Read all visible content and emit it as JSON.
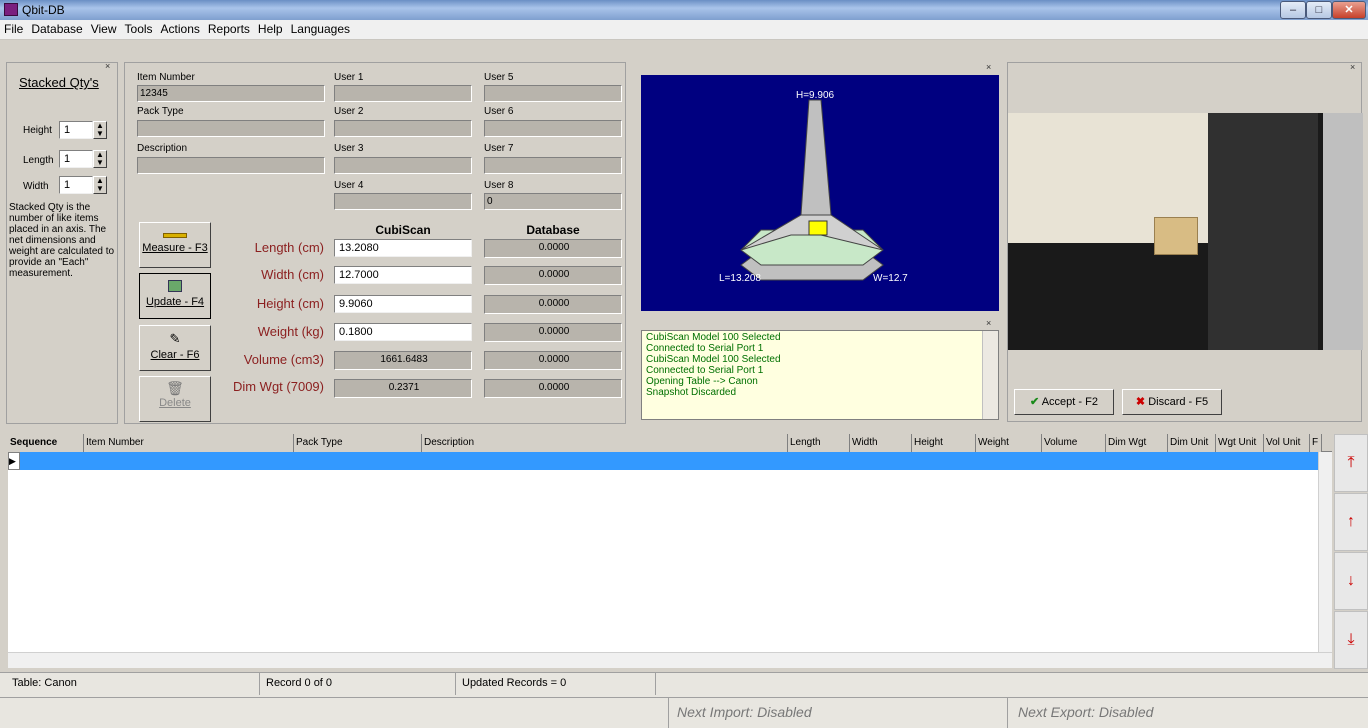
{
  "window": {
    "title": "Qbit-DB"
  },
  "menu": [
    "File",
    "Database",
    "View",
    "Tools",
    "Actions",
    "Reports",
    "Help",
    "Languages"
  ],
  "stacked": {
    "title": "Stacked Qty's",
    "height_label": "Height",
    "height_value": "1",
    "length_label": "Length",
    "length_value": "1",
    "width_label": "Width",
    "width_value": "1",
    "description": "Stacked Qty is the number of  like items placed in an axis. The net dimensions and weight are calculated to provide an \"Each\" measurement."
  },
  "fields": {
    "item_number_label": "Item Number",
    "item_number_value": "12345",
    "pack_type_label": "Pack Type",
    "pack_type_value": "",
    "description_label": "Description",
    "description_value": "",
    "user1_label": "User 1",
    "user2_label": "User 2",
    "user3_label": "User 3",
    "user4_label": "User 4",
    "user5_label": "User 5",
    "user6_label": "User 6",
    "user7_label": "User 7",
    "user8_label": "User 8",
    "user8_value": "0"
  },
  "actions": {
    "measure": "Measure - F3",
    "update": "Update - F4",
    "clear": "Clear - F6",
    "delete": "Delete"
  },
  "measurements": {
    "cubiscan_header": "CubiScan",
    "database_header": "Database",
    "rows": [
      {
        "label": "Length (cm)",
        "cubiscan": "13.2080",
        "database": "0.0000"
      },
      {
        "label": "Width (cm)",
        "cubiscan": "12.7000",
        "database": "0.0000"
      },
      {
        "label": "Height (cm)",
        "cubiscan": "9.9060",
        "database": "0.0000"
      },
      {
        "label": "Weight (kg)",
        "cubiscan": "0.1800",
        "database": "0.0000"
      },
      {
        "label": "Volume (cm3)",
        "cubiscan": "1661.6483",
        "database": "0.0000"
      },
      {
        "label": "Dim Wgt (7009)",
        "cubiscan": "0.2371",
        "database": "0.0000"
      }
    ]
  },
  "diagram": {
    "h_label": "H=9.906",
    "l_label": "L=13.208",
    "w_label": "W=12.7"
  },
  "log": [
    "CubiScan Model 100 Selected",
    "Connected to Serial Port 1",
    "CubiScan Model 100 Selected",
    "Connected to Serial Port 1",
    "Opening Table --> Canon",
    "Snapshot Discarded"
  ],
  "camera": {
    "accept": "Accept - F2",
    "discard": "Discard - F5"
  },
  "grid": {
    "columns": [
      "Sequence",
      "Item Number",
      "Pack Type",
      "Description",
      "Length",
      "Width",
      "Height",
      "Weight",
      "Volume",
      "Dim Wgt",
      "Dim Unit",
      "Wgt Unit",
      "Vol Unit",
      "F"
    ]
  },
  "status": {
    "table": "Table: Canon",
    "record": "Record 0 of 0",
    "updated": "Updated Records = 0",
    "next_import": "Next Import: Disabled",
    "next_export": "Next Export: Disabled"
  },
  "colors": {
    "diagram_bg": "#000080",
    "log_bg": "#ffffe0",
    "log_text": "#007000",
    "label_red": "#8b1f1f",
    "selected_row": "#3399ff"
  }
}
